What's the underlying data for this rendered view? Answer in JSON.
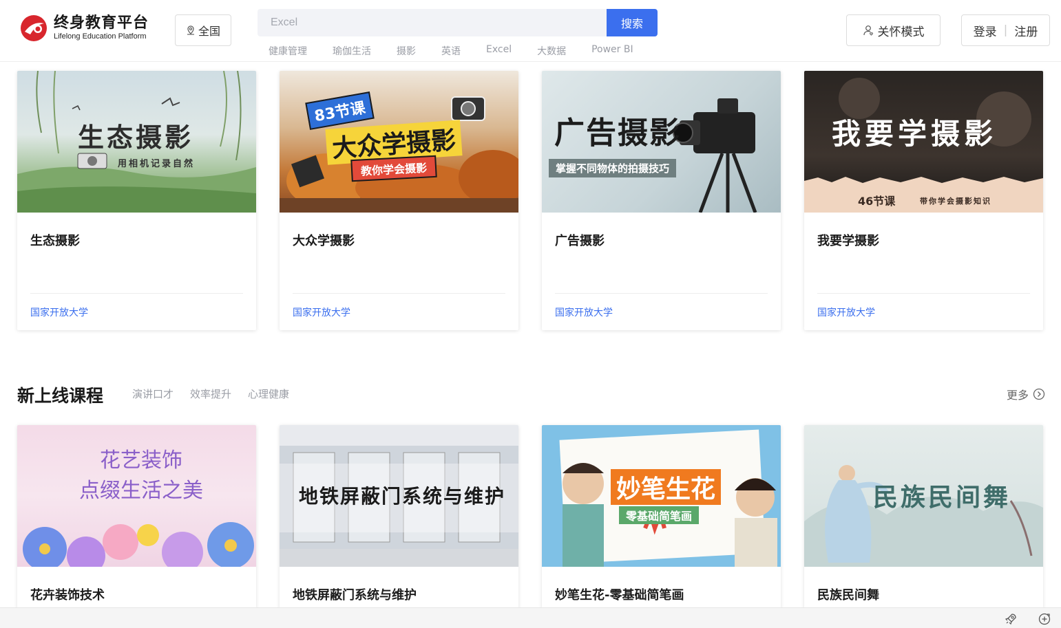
{
  "header": {
    "logo_cn": "终身教育平台",
    "logo_en": "Lifelong Education Platform",
    "region_label": "全国",
    "search_placeholder": "Excel",
    "search_button": "搜索",
    "hot_words": [
      "健康管理",
      "瑜伽生活",
      "摄影",
      "英语",
      "Excel",
      "大数据",
      "Power BI"
    ],
    "care_mode": "关怀模式",
    "login": "登录",
    "register": "注册",
    "accent_color": "#3b6fee"
  },
  "top_cards": [
    {
      "title": "生态摄影",
      "org": "国家开放大学",
      "cover_text": "生态摄影",
      "cover_sub": "用相机记录自然"
    },
    {
      "title": "大众学摄影",
      "org": "国家开放大学",
      "cover_badge": "83节课",
      "cover_text": "大众学摄影",
      "cover_sub": "教你学会摄影"
    },
    {
      "title": "广告摄影",
      "org": "国家开放大学",
      "cover_text": "广告摄影",
      "cover_sub": "掌握不同物体的拍摄技巧"
    },
    {
      "title": "我要学摄影",
      "org": "国家开放大学",
      "cover_text": "我要学摄影",
      "cover_badge": "46节课",
      "cover_sub": "带你学会摄影知识"
    }
  ],
  "new_section": {
    "title": "新上线课程",
    "tabs": [
      "演讲口才",
      "效率提升",
      "心理健康"
    ],
    "more": "更多"
  },
  "new_cards": [
    {
      "title": "花卉装饰技术",
      "cover_line1": "花艺装饰",
      "cover_line2": "点缀生活之美"
    },
    {
      "title": "地铁屏蔽门系统与维护",
      "cover_text": "地铁屏蔽门系统与维护"
    },
    {
      "title": "妙笔生花-零基础简笔画",
      "cover_text": "妙笔生花",
      "cover_sub": "零基础简笔画"
    },
    {
      "title": "民族民间舞",
      "cover_text": "民族民间舞"
    }
  ]
}
